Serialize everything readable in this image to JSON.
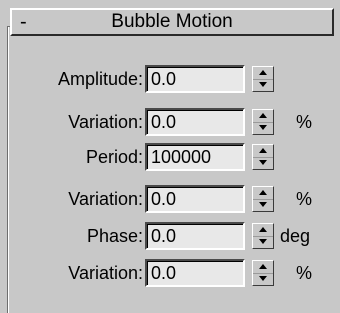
{
  "rollout": {
    "collapse_symbol": "-",
    "title": "Bubble Motion"
  },
  "params": [
    {
      "label": "Amplitude:",
      "value": "0.0",
      "unit": ""
    },
    {
      "label": "Variation:",
      "value": "0.0",
      "unit": "%"
    },
    {
      "label": "Period:",
      "value": "100000",
      "unit": ""
    },
    {
      "label": "Variation:",
      "value": "0.0",
      "unit": "%"
    },
    {
      "label": "Phase:",
      "value": "0.0",
      "unit": "deg"
    },
    {
      "label": "Variation:",
      "value": "0.0",
      "unit": "%"
    }
  ],
  "icons": {
    "spinner_up": "spinner-up-arrow-icon",
    "spinner_down": "spinner-down-arrow-icon"
  }
}
